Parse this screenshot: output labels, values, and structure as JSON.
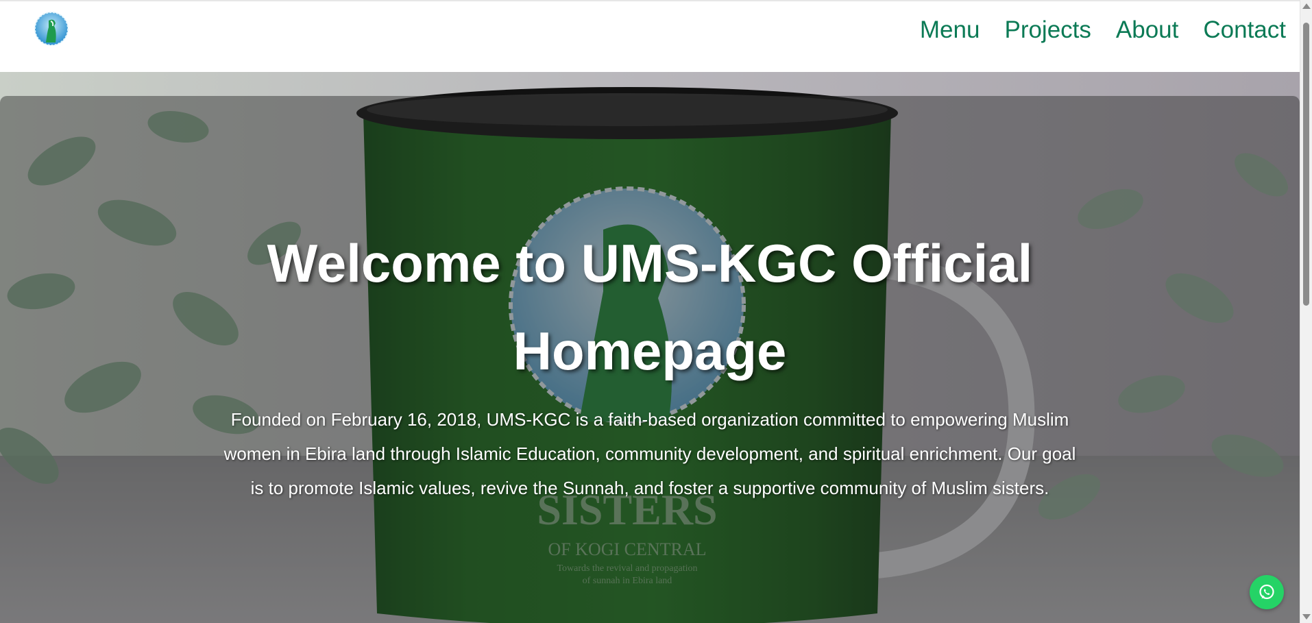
{
  "header": {
    "logo_icon": "ums-kgc-logo",
    "nav": [
      {
        "label": "Menu"
      },
      {
        "label": "Projects"
      },
      {
        "label": "About"
      },
      {
        "label": "Contact"
      }
    ],
    "accent_color": "#0b7a55"
  },
  "hero": {
    "title": "Welcome to UMS-KGC Official Homepage",
    "text": "Founded on February 16, 2018, UMS-KGC is a faith-based organization committed to empowering Muslim women in Ebira land through Islamic Education, community development, and spiritual enrichment. Our goal is to promote Islamic values, revive the Sunnah, and foster a supportive community of Muslim sisters.",
    "background_image": "green-mug-with-logo",
    "mug_print": {
      "line1": "SISTERS",
      "line2": "OF KOGI CENTRAL",
      "line3": "Towards the revival and propagation",
      "line4": "of sunnah in Ebira land"
    }
  },
  "floating": {
    "whatsapp_icon": "whatsapp-icon",
    "whatsapp_color": "#25d366"
  }
}
